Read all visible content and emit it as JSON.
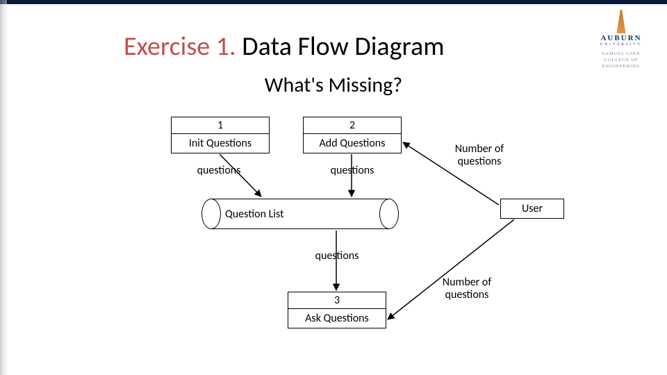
{
  "title": {
    "prefix": "Exercise 1.",
    "main": " Data Flow Diagram"
  },
  "subtitle": "What's Missing?",
  "logo": {
    "name": "AUBURN",
    "sub": "UNIVERSITY",
    "college1": "SAMUEL GINN",
    "college2": "COLLEGE OF ENGINEERING"
  },
  "processes": {
    "p1": {
      "num": "1",
      "name": "Init Questions"
    },
    "p2": {
      "num": "2",
      "name": "Add Questions"
    },
    "p3": {
      "num": "3",
      "name": "Ask Questions"
    }
  },
  "store": {
    "name": "Question List"
  },
  "external": {
    "user": "User"
  },
  "flows": {
    "p1_to_store": "questions",
    "p2_to_store": "questions",
    "store_to_p3": "questions",
    "user_to_p2": "Number of\nquestions",
    "user_to_p3": "Number of\nquestions"
  }
}
